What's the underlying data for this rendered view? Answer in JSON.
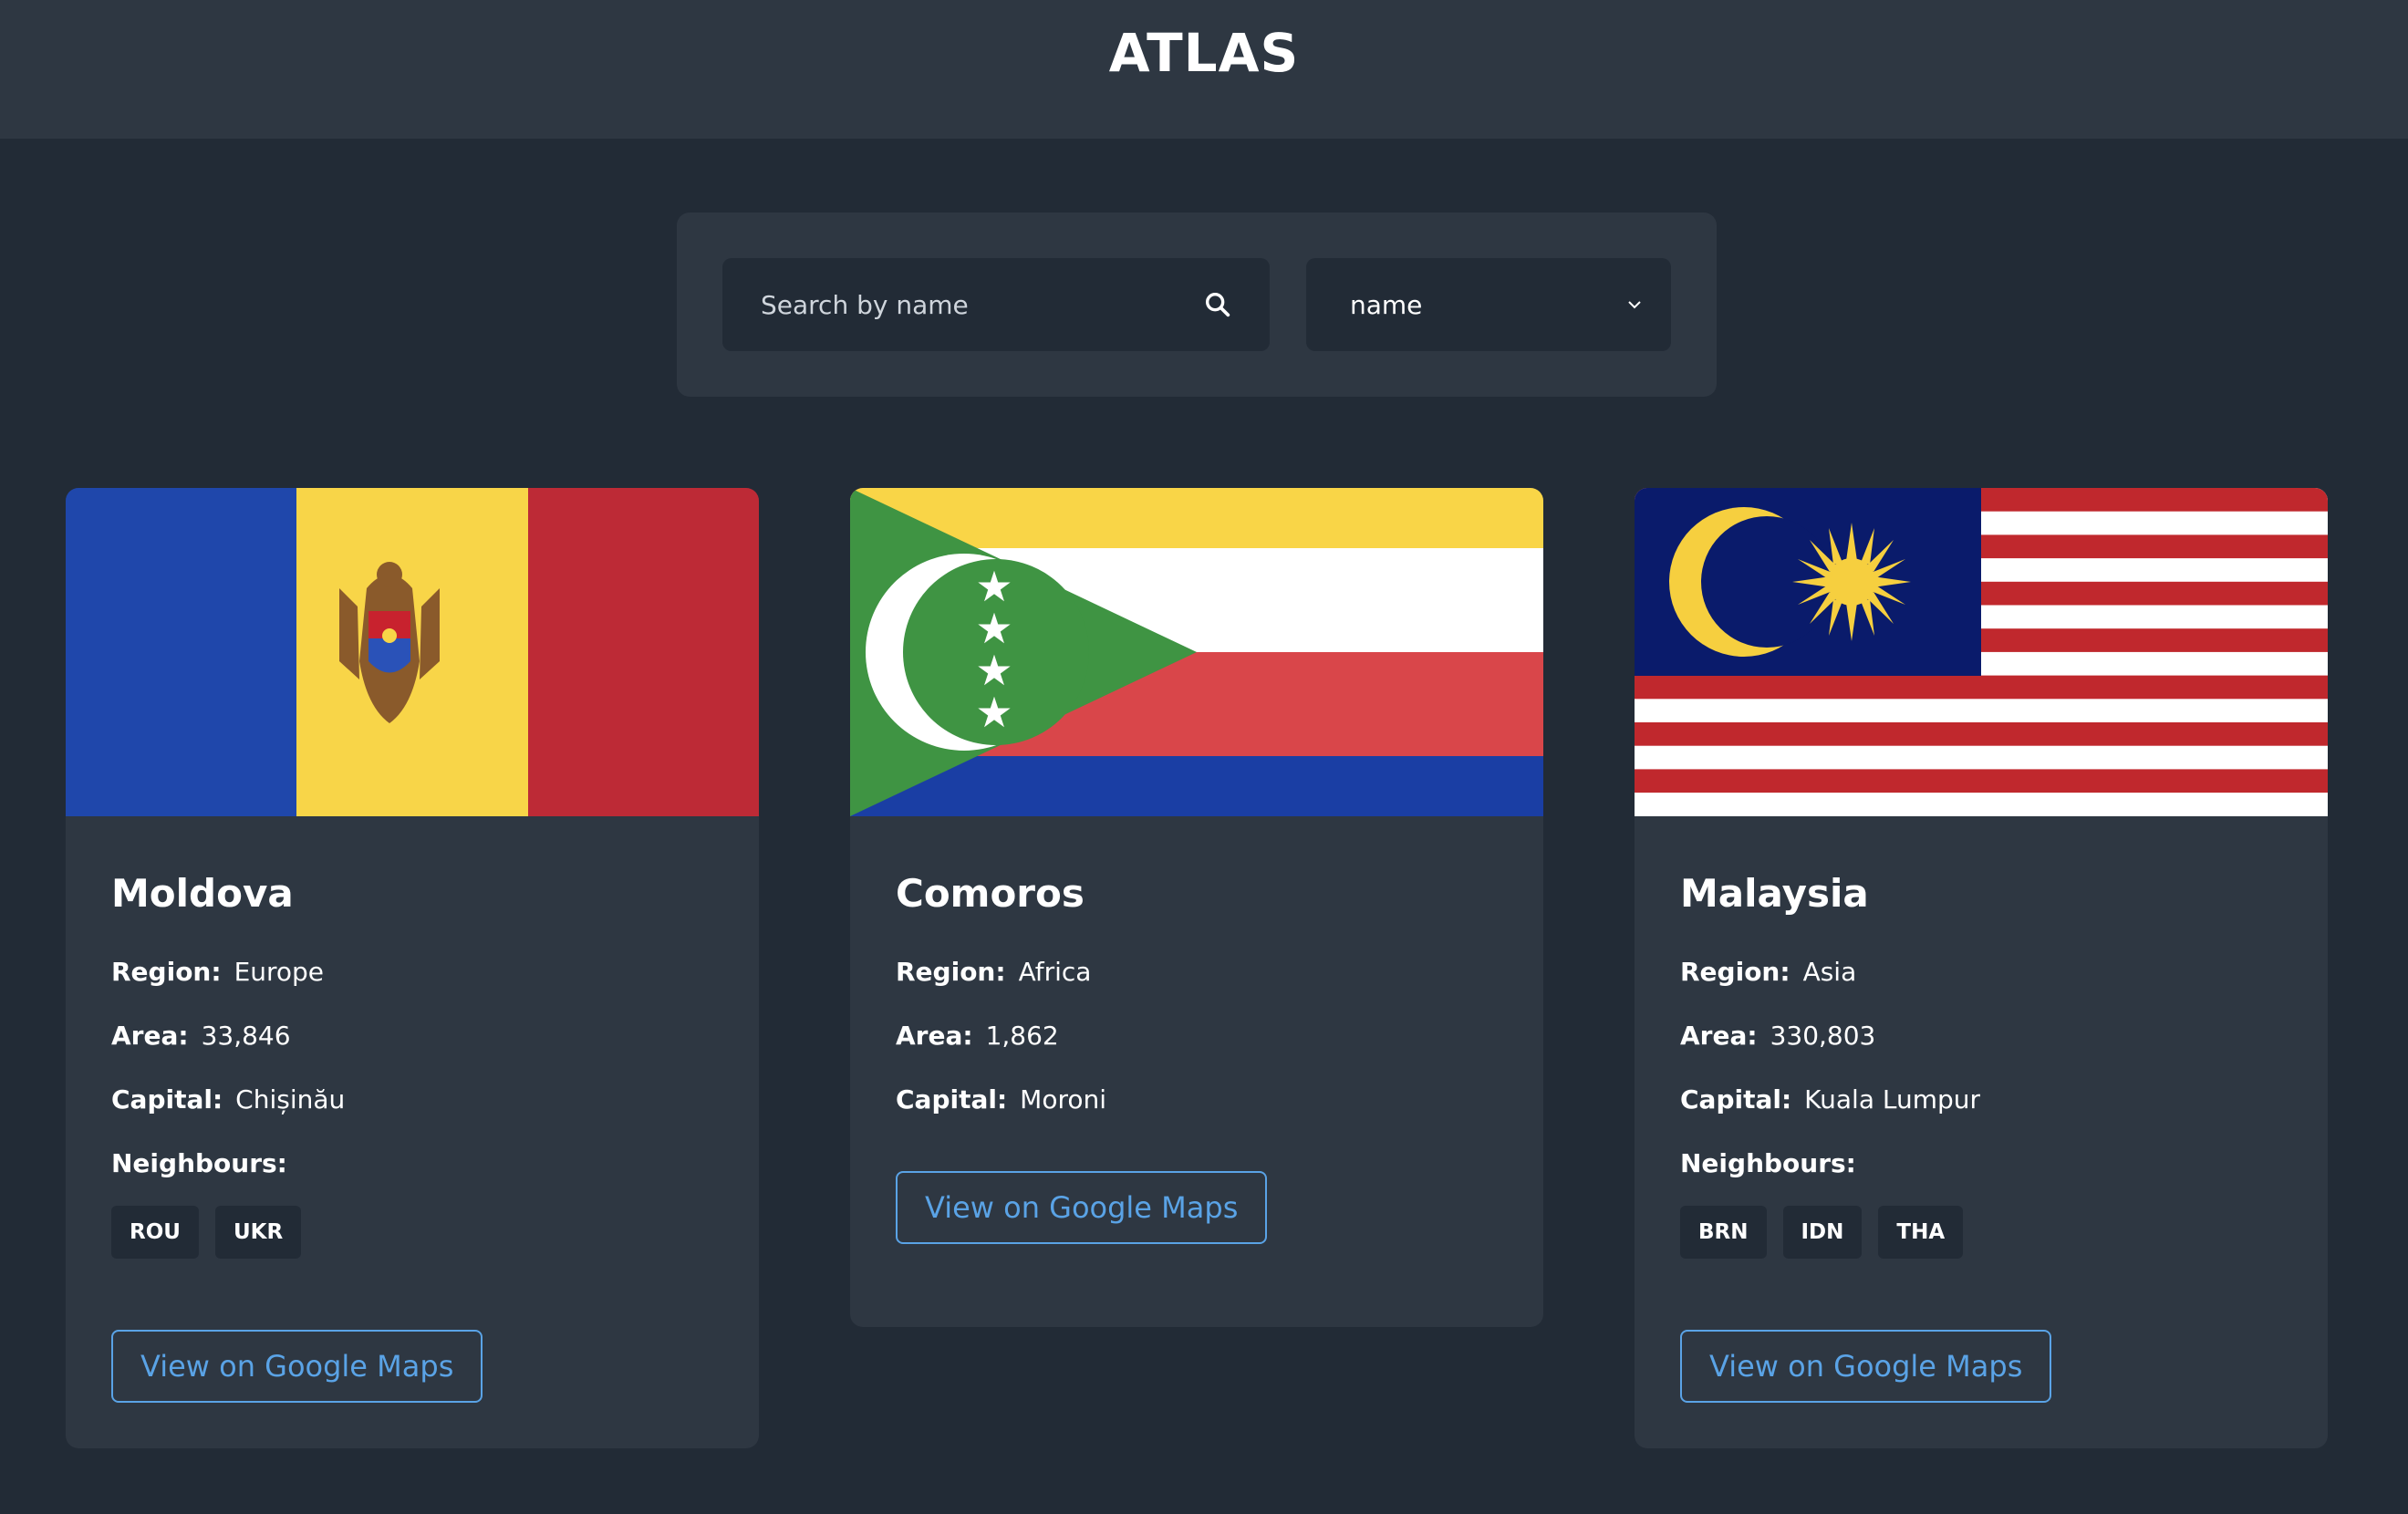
{
  "header": {
    "title": "ATLAS"
  },
  "search": {
    "placeholder": "Search by name",
    "value": ""
  },
  "sort": {
    "selected": "name"
  },
  "colors": {
    "background": "#222b36",
    "panel": "#2e3742",
    "accent": "#5aa3e6"
  },
  "labels": {
    "region": "Region:",
    "area": "Area:",
    "capital": "Capital:",
    "neighbours": "Neighbours:",
    "maps": "View on Google Maps"
  },
  "countries": [
    {
      "name": "Moldova",
      "region": "Europe",
      "area": "33,846",
      "capital": "Chișinău",
      "neighbours": [
        "ROU",
        "UKR"
      ],
      "flag": "moldova-flag"
    },
    {
      "name": "Comoros",
      "region": "Africa",
      "area": "1,862",
      "capital": "Moroni",
      "neighbours": [],
      "flag": "comoros-flag"
    },
    {
      "name": "Malaysia",
      "region": "Asia",
      "area": "330,803",
      "capital": "Kuala Lumpur",
      "neighbours": [
        "BRN",
        "IDN",
        "THA"
      ],
      "flag": "malaysia-flag"
    }
  ]
}
